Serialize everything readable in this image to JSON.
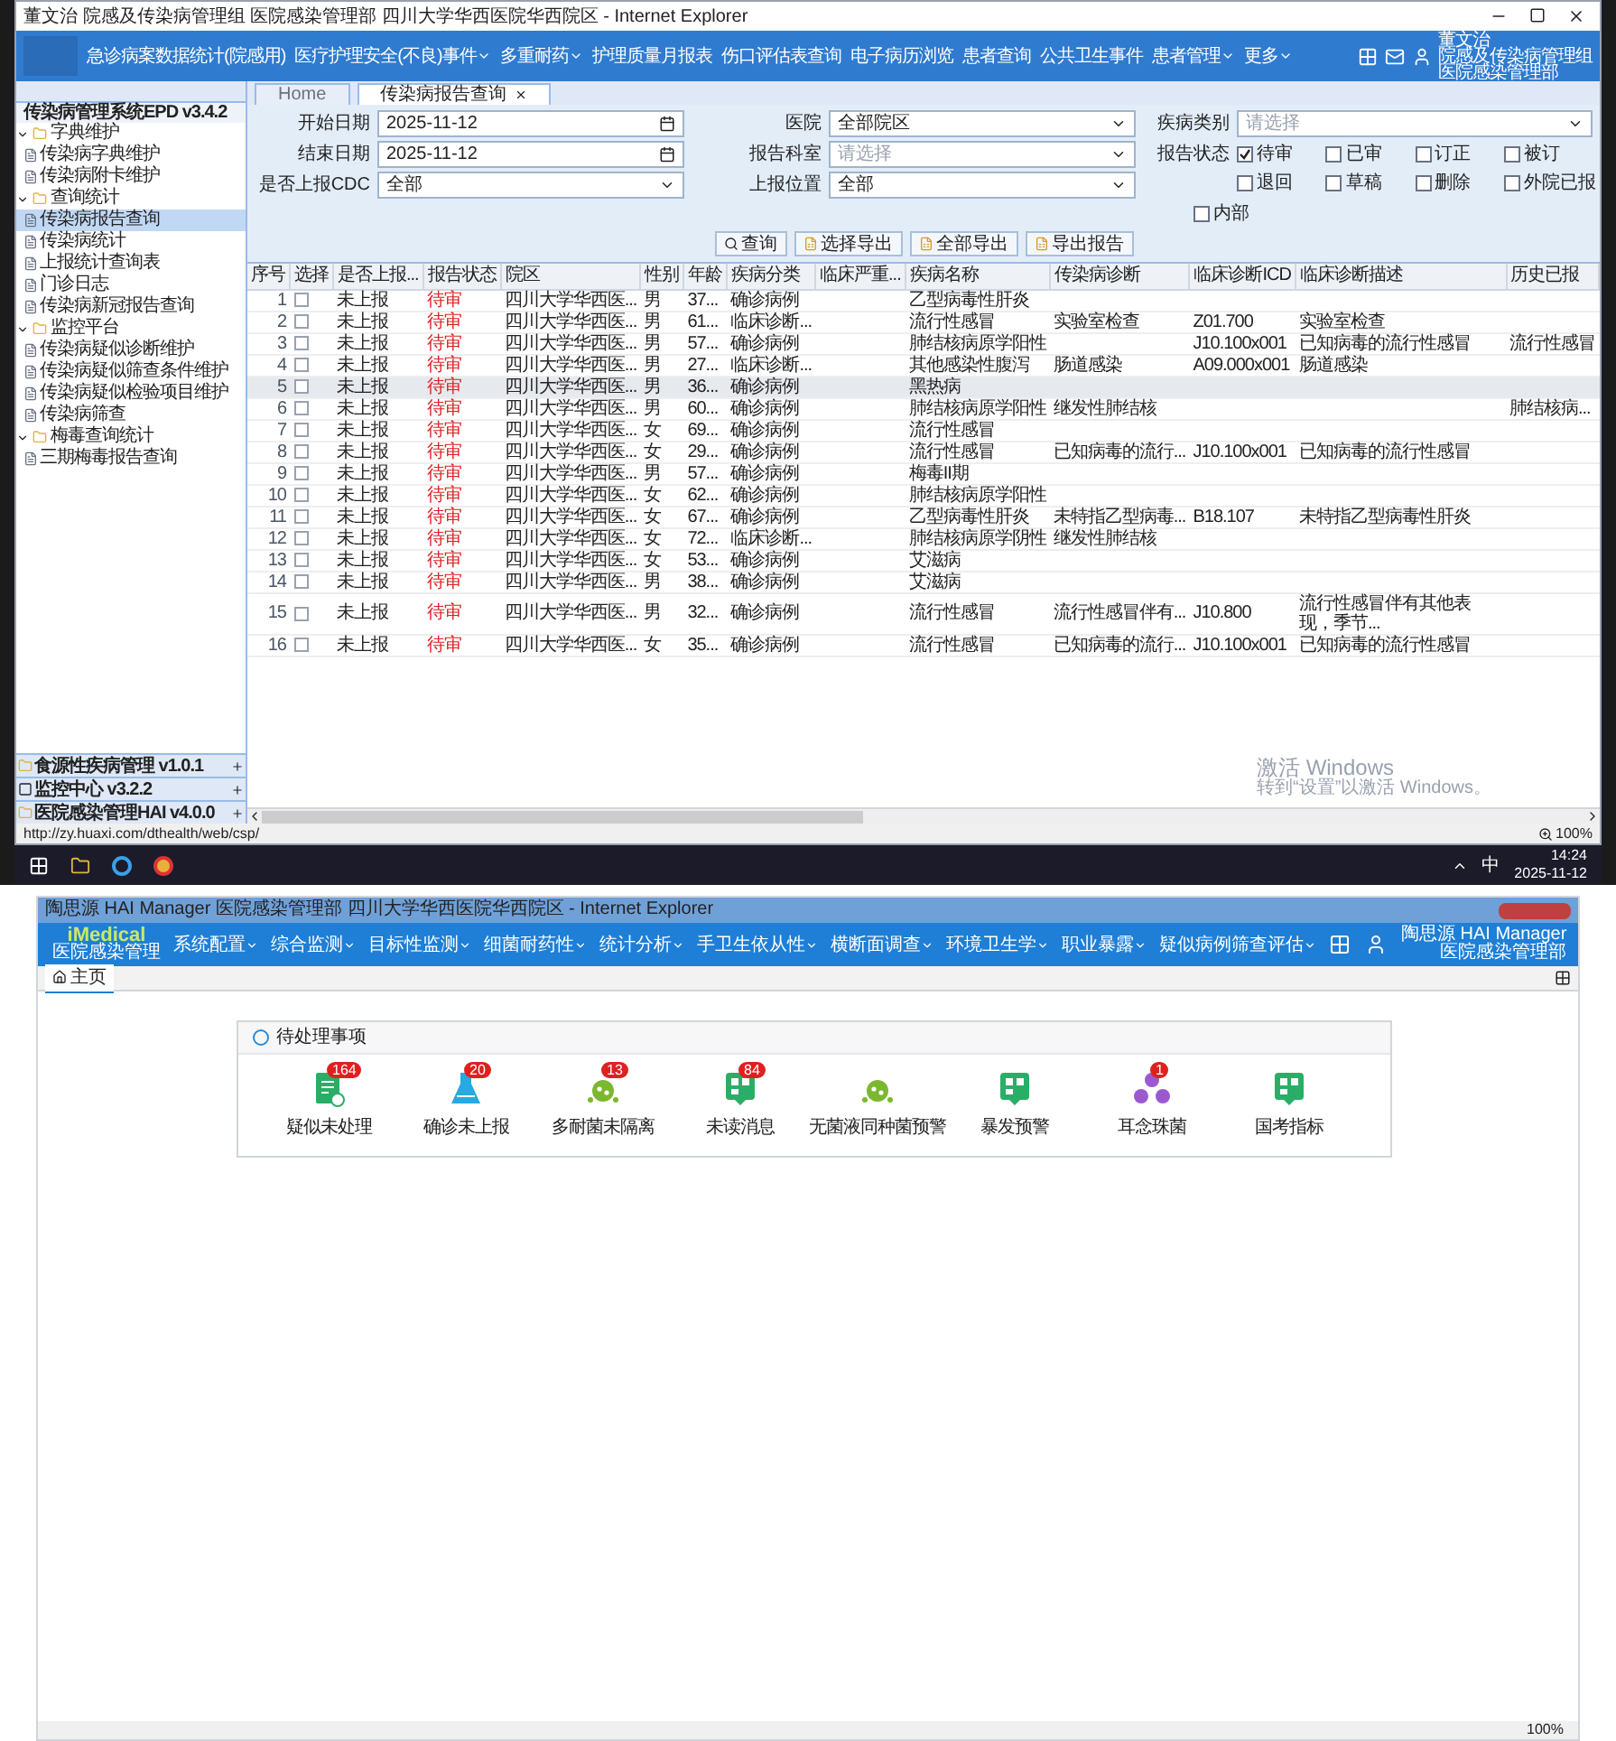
{
  "top_window": {
    "title": "董文治 院感及传染病管理组 医院感染管理部 四川大学华西医院华西院区 - Internet Explorer",
    "nav": [
      {
        "label": "急诊病案数据统计(院感用)",
        "dropdown": false
      },
      {
        "label": "医疗护理安全(不良)事件",
        "dropdown": true
      },
      {
        "label": "多重耐药",
        "dropdown": true
      },
      {
        "label": "护理质量月报表",
        "dropdown": false
      },
      {
        "label": "伤口评估表查询",
        "dropdown": false
      },
      {
        "label": "电子病历浏览",
        "dropdown": false
      },
      {
        "label": "患者查询",
        "dropdown": false
      },
      {
        "label": "公共卫生事件",
        "dropdown": false
      },
      {
        "label": "患者管理",
        "dropdown": true
      },
      {
        "label": "更多",
        "dropdown": true
      }
    ],
    "user": {
      "name": "董文治",
      "group": "院感及传染病管理组",
      "dept": "医院感染管理部"
    },
    "sidebar": {
      "title": "传染病管理系统EPD v3.4.2",
      "tree": [
        {
          "label": "字典维护",
          "expanded": true,
          "children": [
            {
              "label": "传染病字典维护",
              "selected": false
            },
            {
              "label": "传染病附卡维护",
              "selected": false
            }
          ]
        },
        {
          "label": "查询统计",
          "expanded": true,
          "children": [
            {
              "label": "传染病报告查询",
              "selected": true
            },
            {
              "label": "传染病统计",
              "selected": false
            },
            {
              "label": "上报统计查询表",
              "selected": false
            },
            {
              "label": "门诊日志",
              "selected": false
            },
            {
              "label": "传染病新冠报告查询",
              "selected": false
            }
          ]
        },
        {
          "label": "监控平台",
          "expanded": true,
          "children": [
            {
              "label": "传染病疑似诊断维护",
              "selected": false
            },
            {
              "label": "传染病疑似筛查条件维护",
              "selected": false
            },
            {
              "label": "传染病疑似检验项目维护",
              "selected": false
            },
            {
              "label": "传染病筛查",
              "selected": false
            }
          ]
        },
        {
          "label": "梅毒查询统计",
          "expanded": true,
          "children": [
            {
              "label": "三期梅毒报告查询",
              "selected": false
            }
          ]
        }
      ],
      "modules": [
        {
          "label": "食源性疾病管理 v1.0.1",
          "kind": "folder"
        },
        {
          "label": "监控中心 v3.2.2",
          "kind": "panel"
        },
        {
          "label": "医院感染管理HAI v4.0.0",
          "kind": "folder"
        }
      ]
    },
    "tabs": [
      {
        "label": "Home",
        "selected": false,
        "closable": false
      },
      {
        "label": "传染病报告查询",
        "selected": true,
        "closable": true
      }
    ],
    "filters": {
      "start_date": {
        "label": "开始日期",
        "value": "2025-11-12"
      },
      "end_date": {
        "label": "结束日期",
        "value": "2025-11-12"
      },
      "cdc": {
        "label": "是否上报CDC",
        "value": "全部"
      },
      "hospital": {
        "label": "医院",
        "value": "全部院区"
      },
      "dept": {
        "label": "报告科室",
        "placeholder": "请选择"
      },
      "location": {
        "label": "上报位置",
        "value": "全部"
      },
      "category": {
        "label": "疾病类别",
        "placeholder": "请选择"
      },
      "status_label": "报告状态",
      "statuses": [
        {
          "label": "待审",
          "checked": true
        },
        {
          "label": "已审",
          "checked": false
        },
        {
          "label": "订正",
          "checked": false
        },
        {
          "label": "被订",
          "checked": false
        },
        {
          "label": "退回",
          "checked": false
        },
        {
          "label": "草稿",
          "checked": false
        },
        {
          "label": "删除",
          "checked": false
        },
        {
          "label": "外院已报",
          "checked": false
        }
      ],
      "internal": {
        "label": "内部",
        "checked": false
      }
    },
    "buttons": [
      "查询",
      "选择导出",
      "全部导出",
      "导出报告"
    ],
    "table": {
      "columns": [
        "序号",
        "选择",
        "是否上报...",
        "报告状态",
        "院区",
        "性别",
        "年龄",
        "疾病分类",
        "临床严重...",
        "疾病名称",
        "传染病诊断",
        "临床诊断ICD",
        "临床诊断描述",
        "历史已报"
      ],
      "rows": [
        {
          "selected": false,
          "checked": false,
          "cells": [
            "1",
            "",
            "未上报",
            "待审",
            "四川大学华西医...",
            "男",
            "37...",
            "确诊病例",
            "",
            "乙型病毒性肝炎",
            "",
            "",
            "",
            ""
          ]
        },
        {
          "selected": false,
          "checked": false,
          "cells": [
            "2",
            "",
            "未上报",
            "待审",
            "四川大学华西医...",
            "男",
            "61...",
            "临床诊断...",
            "",
            "流行性感冒",
            "实验室检查",
            "Z01.700",
            "实验室检查",
            ""
          ]
        },
        {
          "selected": false,
          "checked": false,
          "cells": [
            "3",
            "",
            "未上报",
            "待审",
            "四川大学华西医...",
            "男",
            "57...",
            "确诊病例",
            "",
            "肺结核病原学阳性",
            "",
            "J10.100x001",
            "已知病毒的流行性感冒",
            "流行性感冒"
          ]
        },
        {
          "selected": false,
          "checked": false,
          "cells": [
            "4",
            "",
            "未上报",
            "待审",
            "四川大学华西医...",
            "男",
            "27...",
            "临床诊断...",
            "",
            "其他感染性腹泻",
            "肠道感染",
            "A09.000x001",
            "肠道感染",
            ""
          ]
        },
        {
          "selected": true,
          "checked": false,
          "cells": [
            "5",
            "",
            "未上报",
            "待审",
            "四川大学华西医...",
            "男",
            "36...",
            "确诊病例",
            "",
            "黑热病",
            "",
            "",
            "",
            ""
          ]
        },
        {
          "selected": false,
          "checked": false,
          "cells": [
            "6",
            "",
            "未上报",
            "待审",
            "四川大学华西医...",
            "男",
            "60...",
            "确诊病例",
            "",
            "肺结核病原学阳性",
            "继发性肺结核",
            "",
            "",
            "肺结核病..."
          ]
        },
        {
          "selected": false,
          "checked": false,
          "cells": [
            "7",
            "",
            "未上报",
            "待审",
            "四川大学华西医...",
            "女",
            "69...",
            "确诊病例",
            "",
            "流行性感冒",
            "",
            "",
            "",
            ""
          ]
        },
        {
          "selected": false,
          "checked": false,
          "cells": [
            "8",
            "",
            "未上报",
            "待审",
            "四川大学华西医...",
            "女",
            "29...",
            "确诊病例",
            "",
            "流行性感冒",
            "已知病毒的流行...",
            "J10.100x001",
            "已知病毒的流行性感冒",
            ""
          ]
        },
        {
          "selected": false,
          "checked": false,
          "cells": [
            "9",
            "",
            "未上报",
            "待审",
            "四川大学华西医...",
            "男",
            "57...",
            "确诊病例",
            "",
            "梅毒II期",
            "",
            "",
            "",
            ""
          ]
        },
        {
          "selected": false,
          "checked": false,
          "cells": [
            "10",
            "",
            "未上报",
            "待审",
            "四川大学华西医...",
            "女",
            "62...",
            "确诊病例",
            "",
            "肺结核病原学阳性",
            "",
            "",
            "",
            ""
          ]
        },
        {
          "selected": false,
          "checked": false,
          "cells": [
            "11",
            "",
            "未上报",
            "待审",
            "四川大学华西医...",
            "女",
            "67...",
            "确诊病例",
            "",
            "乙型病毒性肝炎",
            "未特指乙型病毒...",
            "B18.107",
            "未特指乙型病毒性肝炎",
            ""
          ]
        },
        {
          "selected": false,
          "checked": false,
          "cells": [
            "12",
            "",
            "未上报",
            "待审",
            "四川大学华西医...",
            "女",
            "72...",
            "临床诊断...",
            "",
            "肺结核病原学阴性",
            "继发性肺结核",
            "",
            "",
            ""
          ]
        },
        {
          "selected": false,
          "checked": false,
          "cells": [
            "13",
            "",
            "未上报",
            "待审",
            "四川大学华西医...",
            "女",
            "53...",
            "确诊病例",
            "",
            "艾滋病",
            "",
            "",
            "",
            ""
          ]
        },
        {
          "selected": false,
          "checked": false,
          "cells": [
            "14",
            "",
            "未上报",
            "待审",
            "四川大学华西医...",
            "男",
            "38...",
            "确诊病例",
            "",
            "艾滋病",
            "",
            "",
            "",
            ""
          ]
        },
        {
          "selected": false,
          "checked": false,
          "cells": [
            "15",
            "",
            "未上报",
            "待审",
            "四川大学华西医...",
            "男",
            "32...",
            "确诊病例",
            "",
            "流行性感冒",
            "流行性感冒伴有...",
            "J10.800",
            "流行性感冒伴有其他表现，季节...",
            ""
          ]
        },
        {
          "selected": false,
          "checked": false,
          "cells": [
            "16",
            "",
            "未上报",
            "待审",
            "四川大学华西医...",
            "女",
            "35...",
            "确诊病例",
            "",
            "流行性感冒",
            "已知病毒的流行...",
            "J10.100x001",
            "已知病毒的流行性感冒",
            ""
          ]
        }
      ]
    },
    "activation": {
      "title": "激活 Windows",
      "hint": "转到“设置”以激活 Windows。"
    },
    "status_url": "http://zy.huaxi.com/dthealth/web/csp/",
    "zoom": "100%"
  },
  "taskbar": {
    "ime": "中",
    "time": "14:24",
    "date": "2025-11-12"
  },
  "bottom_window": {
    "title": "陶思源 HAI Manager 医院感染管理部 四川大学华西医院华西院区 - Internet Explorer",
    "logo": {
      "name": "iMedical",
      "subtitle": "医院感染管理"
    },
    "nav": [
      "系统配置",
      "综合监测",
      "目标性监测",
      "细菌耐药性",
      "统计分析",
      "手卫生依从性",
      "横断面调查",
      "环境卫生学",
      "职业暴露",
      "疑似病例筛查评估"
    ],
    "user": {
      "name": "陶思源",
      "role": "HAI Manager",
      "dept": "医院感染管理部"
    },
    "tabs": [
      {
        "label": "主页",
        "selected": true
      }
    ],
    "panel_title": "待处理事项",
    "todos": [
      {
        "label": "疑似未处理",
        "badge": "164",
        "kind": "doc",
        "color": "#2aae67"
      },
      {
        "label": "确诊未上报",
        "badge": "20",
        "kind": "flask",
        "color": "#27a9e1"
      },
      {
        "label": "多耐菌未隔离",
        "badge": "13",
        "kind": "germ",
        "color": "#7cb82f"
      },
      {
        "label": "未读消息",
        "badge": "84",
        "kind": "chat",
        "color": "#2aae67"
      },
      {
        "label": "无菌液同种菌预警",
        "kind": "germ",
        "color": "#7cb82f"
      },
      {
        "label": "暴发预警",
        "kind": "chat",
        "color": "#2aae67"
      },
      {
        "label": "耳念珠菌",
        "badge": "1",
        "kind": "hazard",
        "color": "#9b59d0"
      },
      {
        "label": "国考指标",
        "kind": "chat",
        "color": "#2aae67"
      }
    ],
    "zoom": "100%"
  }
}
